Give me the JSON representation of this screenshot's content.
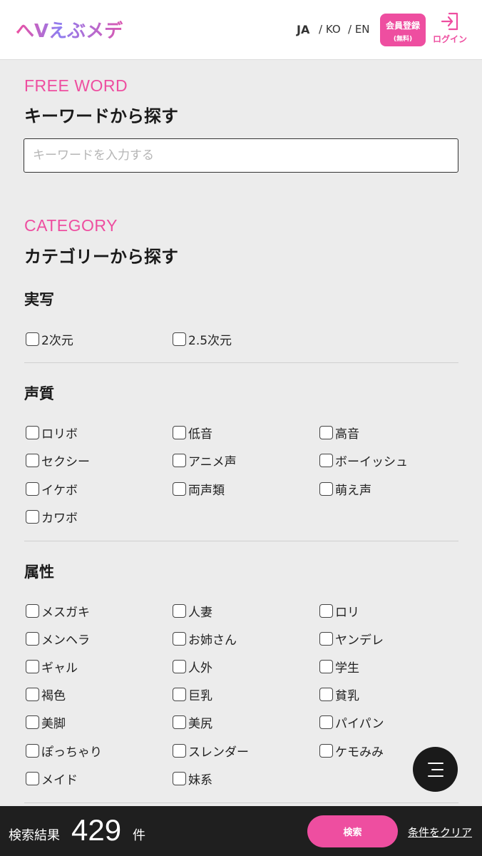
{
  "header": {
    "logo_text": "へVえぶメディ",
    "languages": [
      "JA",
      "/ KO",
      "/ EN"
    ],
    "signup_line1": "会員登録",
    "signup_line2": "(無料)",
    "login_label": "ログイン"
  },
  "free_word": {
    "eyebrow": "FREE WORD",
    "title": "キーワードから探す",
    "placeholder": "キーワードを入力する"
  },
  "category": {
    "eyebrow": "CATEGORY",
    "title": "カテゴリーから探す",
    "groups": [
      {
        "title": "実写",
        "options": [
          "2次元",
          "2.5次元"
        ]
      },
      {
        "title": "声質",
        "options": [
          "ロリボ",
          "低音",
          "高音",
          "セクシー",
          "アニメ声",
          "ボーイッシュ",
          "イケボ",
          "両声類",
          "萌え声",
          "カワボ"
        ]
      },
      {
        "title": "属性",
        "options": [
          "メスガキ",
          "人妻",
          "ロリ",
          "メンヘラ",
          "お姉さん",
          "ヤンデレ",
          "ギャル",
          "人外",
          "学生",
          "褐色",
          "巨乳",
          "貧乳",
          "美脚",
          "美尻",
          "パイパン",
          "ぽっちゃり",
          "スレンダー",
          "ケモみみ",
          "メイド",
          "妹系"
        ]
      }
    ]
  },
  "footer": {
    "result_label": "検索結果",
    "result_count": "429",
    "result_unit": "件",
    "search_label": "検索",
    "clear_label": "条件をクリア"
  },
  "colors": {
    "accent": "#ee4ea0",
    "footer_bg": "#1f1f1f",
    "page_bg": "#ececec"
  }
}
